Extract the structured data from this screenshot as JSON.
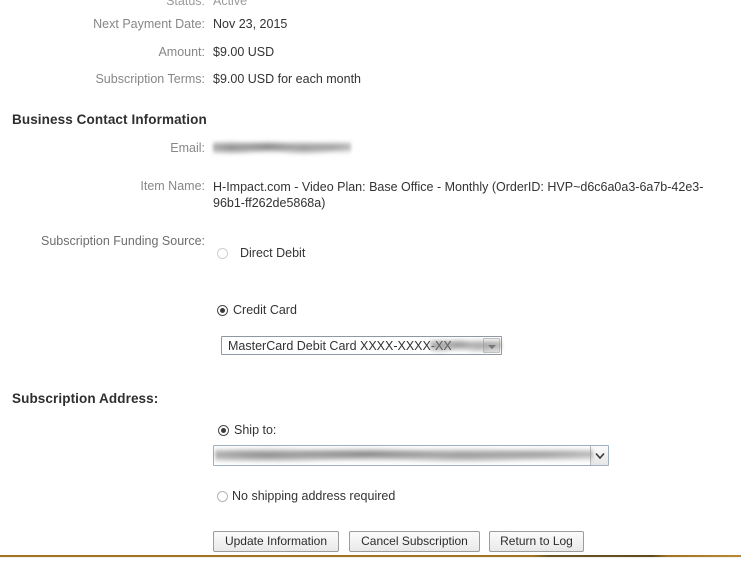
{
  "details": {
    "rows": [
      {
        "label": "Status:",
        "value": "Active"
      },
      {
        "label": "Next Payment Date:",
        "value": "Nov 23, 2015"
      },
      {
        "label": "Amount:",
        "value": "$9.00 USD"
      },
      {
        "label": "Subscription Terms:",
        "value": "$9.00 USD for each month"
      }
    ]
  },
  "business_contact": {
    "heading": "Business Contact Information",
    "email": {
      "label": "Email:",
      "value": "",
      "redacted": true
    },
    "item_name": {
      "label": "Item Name:",
      "value": "H-Impact.com - Video Plan: Base Office - Monthly (OrderID: HVP~d6c6a0a3-6a7b-42e3-96b1-ff262de5868a)"
    }
  },
  "funding_source": {
    "label": "Subscription Funding Source:",
    "options": [
      {
        "label": "Direct Debit",
        "selected": false
      },
      {
        "label": "Credit Card",
        "selected": true
      }
    ],
    "card_select": {
      "value": "MasterCard Debit Card XXXX-XXXX-XX",
      "redacted_tail": true,
      "arrow_icon": "chevron-down-icon"
    }
  },
  "subscription_address": {
    "heading": "Subscription Address:",
    "options": [
      {
        "label": "Ship to:",
        "selected": true
      },
      {
        "label": "No shipping address required",
        "selected": false
      }
    ],
    "address_select": {
      "value": "",
      "redacted": true,
      "arrow_icon": "chevron-down-icon"
    }
  },
  "actions": {
    "update": "Update Information",
    "cancel": "Cancel Subscription",
    "return": "Return to Log"
  },
  "colors": {
    "label_gray": "#878787",
    "value_dark": "#333333",
    "footer_rule": "#a3731f",
    "select_border": "#8d9aa6"
  }
}
